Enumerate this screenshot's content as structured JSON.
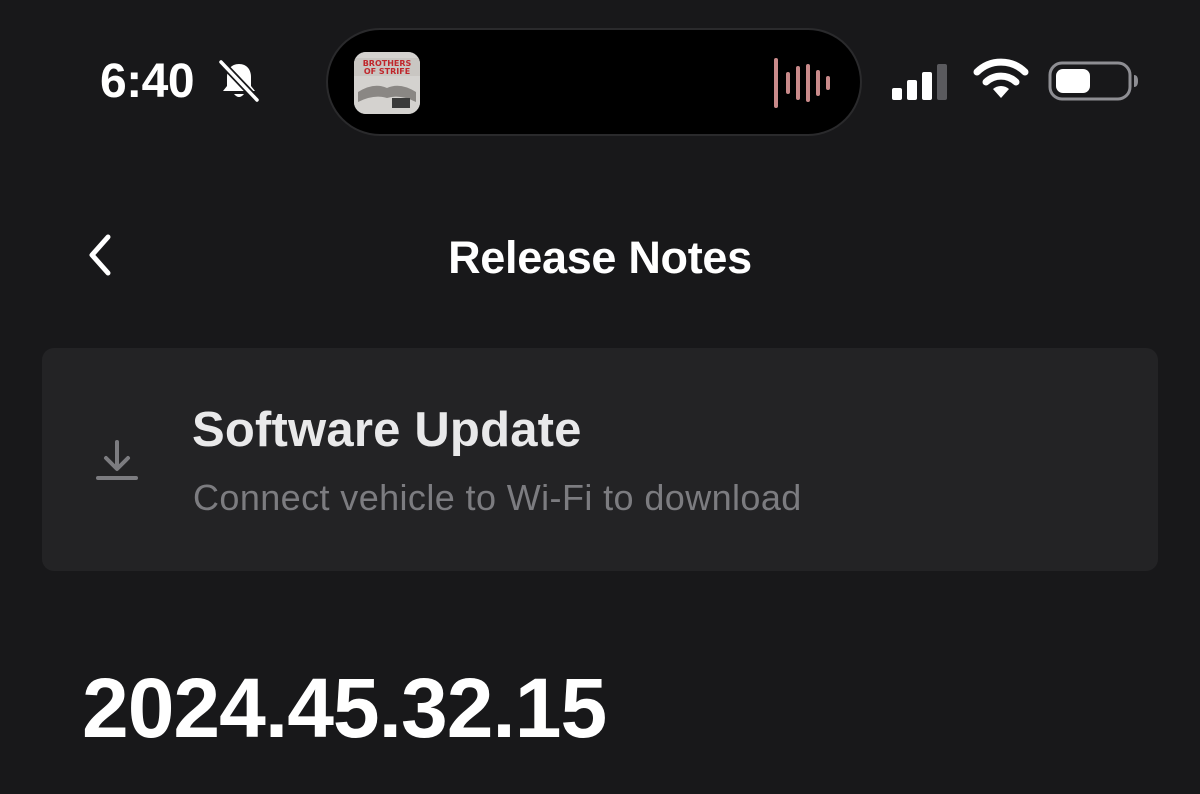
{
  "status_bar": {
    "time": "6:40",
    "silent_icon": "bell-slash-icon",
    "now_playing_icon": "album-art-thumbnail",
    "audio_icon": "waveform-icon",
    "signal_icon": "cellular-signal-icon",
    "wifi_icon": "wifi-icon",
    "battery_icon": "battery-icon"
  },
  "nav": {
    "back_icon": "chevron-left-icon",
    "title": "Release Notes"
  },
  "update_card": {
    "icon": "download-icon",
    "title": "Software Update",
    "subtitle": "Connect vehicle to Wi-Fi to download"
  },
  "release": {
    "version": "2024.45.32.15"
  },
  "colors": {
    "background": "#18181a",
    "card": "#232325",
    "primary_text": "#ffffff",
    "secondary_text": "#7c7c80",
    "waveform_accent": "#c98a8a"
  }
}
